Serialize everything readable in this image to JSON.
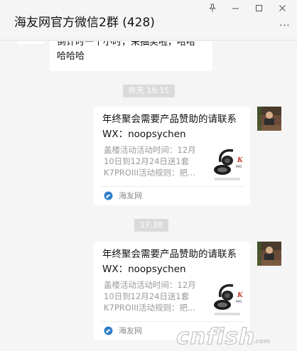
{
  "header": {
    "title": "海友网官方微信2群 (428)",
    "window_buttons": {
      "pin": "⊥",
      "minimize": "—",
      "maximize": "□",
      "close": "✕"
    },
    "more": "···"
  },
  "messages": {
    "top_bubble": {
      "line1": "倒计时一个小时，来抽奖啦，哈哈",
      "line2": "哈哈哈"
    },
    "times": [
      "昨天 19:15",
      "17:38"
    ],
    "cards": [
      {
        "title": "年终聚会需要产品赞助的请联系WX：noopsychen",
        "desc": "盖楼活动活动时间：12月10日到12月24日送1套K7PROIII活动规则：把...",
        "source": "海友网"
      },
      {
        "title": "年终聚会需要产品赞助的请联系WX：noopsychen",
        "desc": "盖楼活动活动时间：12月10日到12月24日送1套K7PROIII活动规则：把...",
        "source": "海友网"
      }
    ]
  },
  "watermark": {
    "text": "cnfish",
    "sub": ".com"
  },
  "colors": {
    "background": "#f5f5f5",
    "bubble": "#ffffff",
    "time_pill": "#dadada",
    "source_logo": "#2f7fc8"
  }
}
